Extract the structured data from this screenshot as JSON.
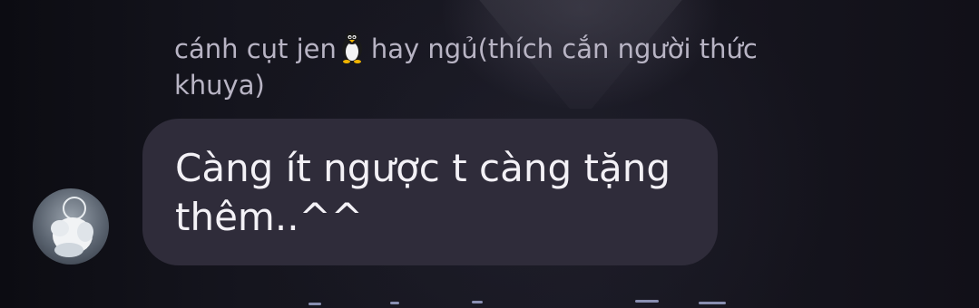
{
  "message": {
    "sender_name_line1": "cánh cụt jen",
    "sender_name_after_emoji": "hay ngủ(thích cắn người thức",
    "sender_name_line2": "khuya)",
    "text_line1": "Càng ít ngược t càng tặng",
    "text_line2": "thêm..^^"
  },
  "icons": {
    "emoji": "penguin-icon",
    "avatar": "avatar"
  },
  "colors": {
    "bubble": "#2f2c3a",
    "sender_text": "#b8b4c4",
    "message_text": "#f3f1f6",
    "background": "#14131c"
  }
}
